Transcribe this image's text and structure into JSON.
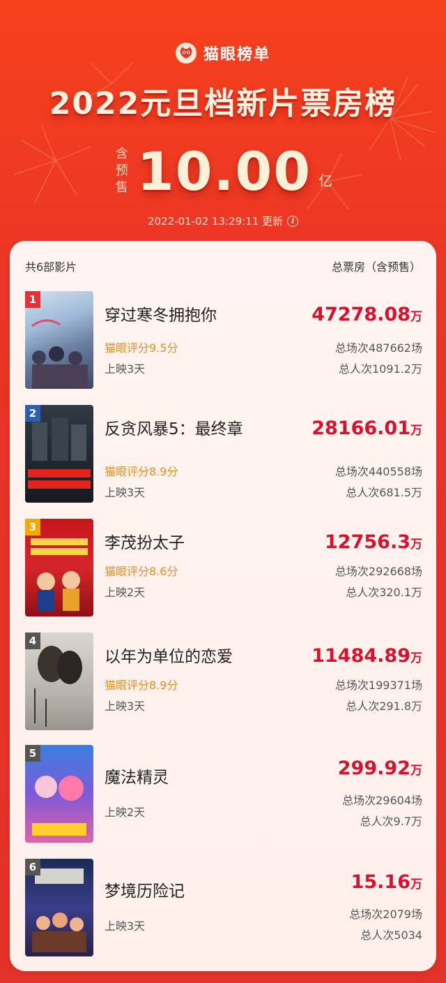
{
  "colors": {
    "accent_red": "#d8122d",
    "score_orange": "#f08b1e",
    "bg_red": "#ea3426"
  },
  "brand": {
    "name": "猫眼榜单",
    "logo_icon": "cat-eye-logo-icon"
  },
  "header": {
    "title": "2022元旦档新片票房榜",
    "presale_tag": "含预售",
    "total": "10.00",
    "unit": "亿",
    "timestamp": "2022-01-02  13:29:11  更新"
  },
  "list": {
    "count_label": "共6部影片",
    "total_label": "总票房（含预售）",
    "wan": "万",
    "items": [
      {
        "rank": "1",
        "title": "穿过寒冬拥抱你",
        "score": "猫眼评分9.5分",
        "days": "上映3天",
        "box": "47278.08",
        "shows": "总场次487662场",
        "people": "总人次1091.2万",
        "rank_color": "#e5303a"
      },
      {
        "rank": "2",
        "title": "反贪风暴5：最终章",
        "score": "猫眼评分8.9分",
        "days": "上映3天",
        "box": "28166.01",
        "shows": "总场次440558场",
        "people": "总人次681.5万",
        "rank_color": "#2c5fae"
      },
      {
        "rank": "3",
        "title": "李茂扮太子",
        "score": "猫眼评分8.6分",
        "days": "上映2天",
        "box": "12756.3",
        "shows": "总场次292668场",
        "people": "总人次320.1万",
        "rank_color": "#f2a900"
      },
      {
        "rank": "4",
        "title": "以年为单位的恋爱",
        "score": "猫眼评分8.9分",
        "days": "上映3天",
        "box": "11484.89",
        "shows": "总场次199371场",
        "people": "总人次291.8万",
        "rank_color": "#555555"
      },
      {
        "rank": "5",
        "title": "魔法精灵",
        "score": "",
        "days": "上映2天",
        "box": "299.92",
        "shows": "总场次29604场",
        "people": "总人次9.7万",
        "rank_color": "#555555"
      },
      {
        "rank": "6",
        "title": "梦境历险记",
        "score": "",
        "days": "上映3天",
        "box": "15.16",
        "shows": "总场次2079场",
        "people": "总人次5034",
        "rank_color": "#555555"
      }
    ]
  }
}
